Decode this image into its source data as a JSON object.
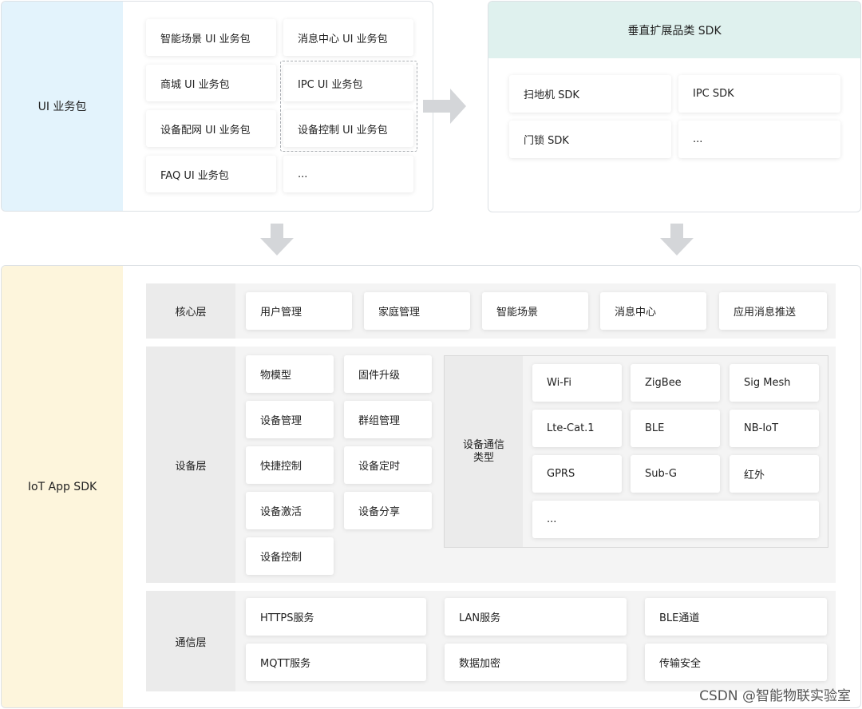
{
  "ui_package": {
    "label": "UI 业务包",
    "items": [
      "智能场景 UI 业务包",
      "消息中心 UI 业务包",
      "商城 UI 业务包",
      "IPC UI 业务包",
      "设备配网 UI 业务包",
      "设备控制 UI 业务包",
      "FAQ UI 业务包",
      "..."
    ]
  },
  "vertical_sdk": {
    "title": "垂直扩展品类 SDK",
    "items": [
      "扫地机 SDK",
      "IPC SDK",
      "门锁 SDK",
      "..."
    ]
  },
  "iot_sdk": {
    "label": "IoT App SDK",
    "core_layer": {
      "label": "核心层",
      "items": [
        "用户管理",
        "家庭管理",
        "智能场景",
        "消息中心",
        "应用消息推送"
      ]
    },
    "device_layer": {
      "label": "设备层",
      "items": [
        "物模型",
        "固件升级",
        "设备管理",
        "群组管理",
        "快捷控制",
        "设备定时",
        "设备激活",
        "设备分享",
        "设备控制"
      ],
      "comm_types": {
        "label_line1": "设备通信",
        "label_line2": "类型",
        "items": [
          "Wi-Fi",
          "ZigBee",
          "Sig Mesh",
          "Lte-Cat.1",
          "BLE",
          "NB-IoT",
          "GPRS",
          "Sub-G",
          "红外",
          "..."
        ]
      }
    },
    "comm_layer": {
      "label": "通信层",
      "items": [
        "HTTPS服务",
        "LAN服务",
        "BLE通道",
        "MQTT服务",
        "数据加密",
        "传输安全"
      ]
    }
  },
  "watermark": "CSDN @智能物联实验室",
  "colors": {
    "ui_side": "#e3f3fc",
    "sdk_header": "#dff1ee",
    "iot_side": "#fdf5dc",
    "arrow": "#d4d6d9"
  }
}
